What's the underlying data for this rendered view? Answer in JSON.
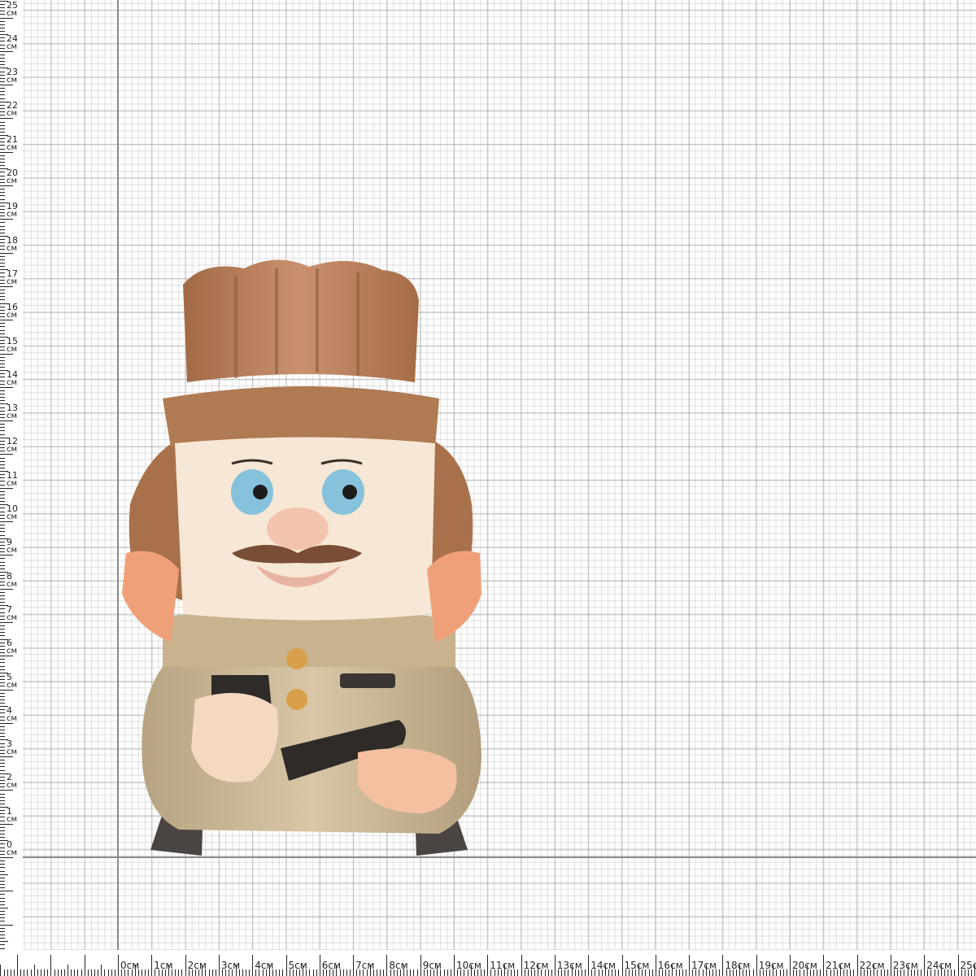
{
  "ruler": {
    "unit": "см",
    "vertical_labels": [
      "25",
      "24",
      "23",
      "22",
      "21",
      "20",
      "19",
      "18",
      "17",
      "16",
      "15",
      "14",
      "13",
      "12",
      "11",
      "10",
      "9",
      "8",
      "7",
      "6",
      "5",
      "4",
      "3",
      "2",
      "1",
      "0"
    ],
    "horizontal_labels": [
      "0см",
      "1см",
      "2см",
      "3см",
      "4см",
      "5см",
      "6см",
      "7см",
      "8см",
      "9см",
      "10см",
      "11см",
      "12см",
      "13см",
      "14см",
      "15см",
      "16см",
      "17см",
      "18см",
      "19см",
      "20см",
      "21см",
      "22см",
      "23см",
      "24см",
      "25с"
    ]
  },
  "photo": {
    "subject": "ceramic-figurine",
    "colors": {
      "hat": "#b07a52",
      "skin": "#f6e7d6",
      "cheek": "#f0a078",
      "eyes": "#86c2dc",
      "jacket": "#cdb896",
      "boots": "#4a4542"
    }
  }
}
